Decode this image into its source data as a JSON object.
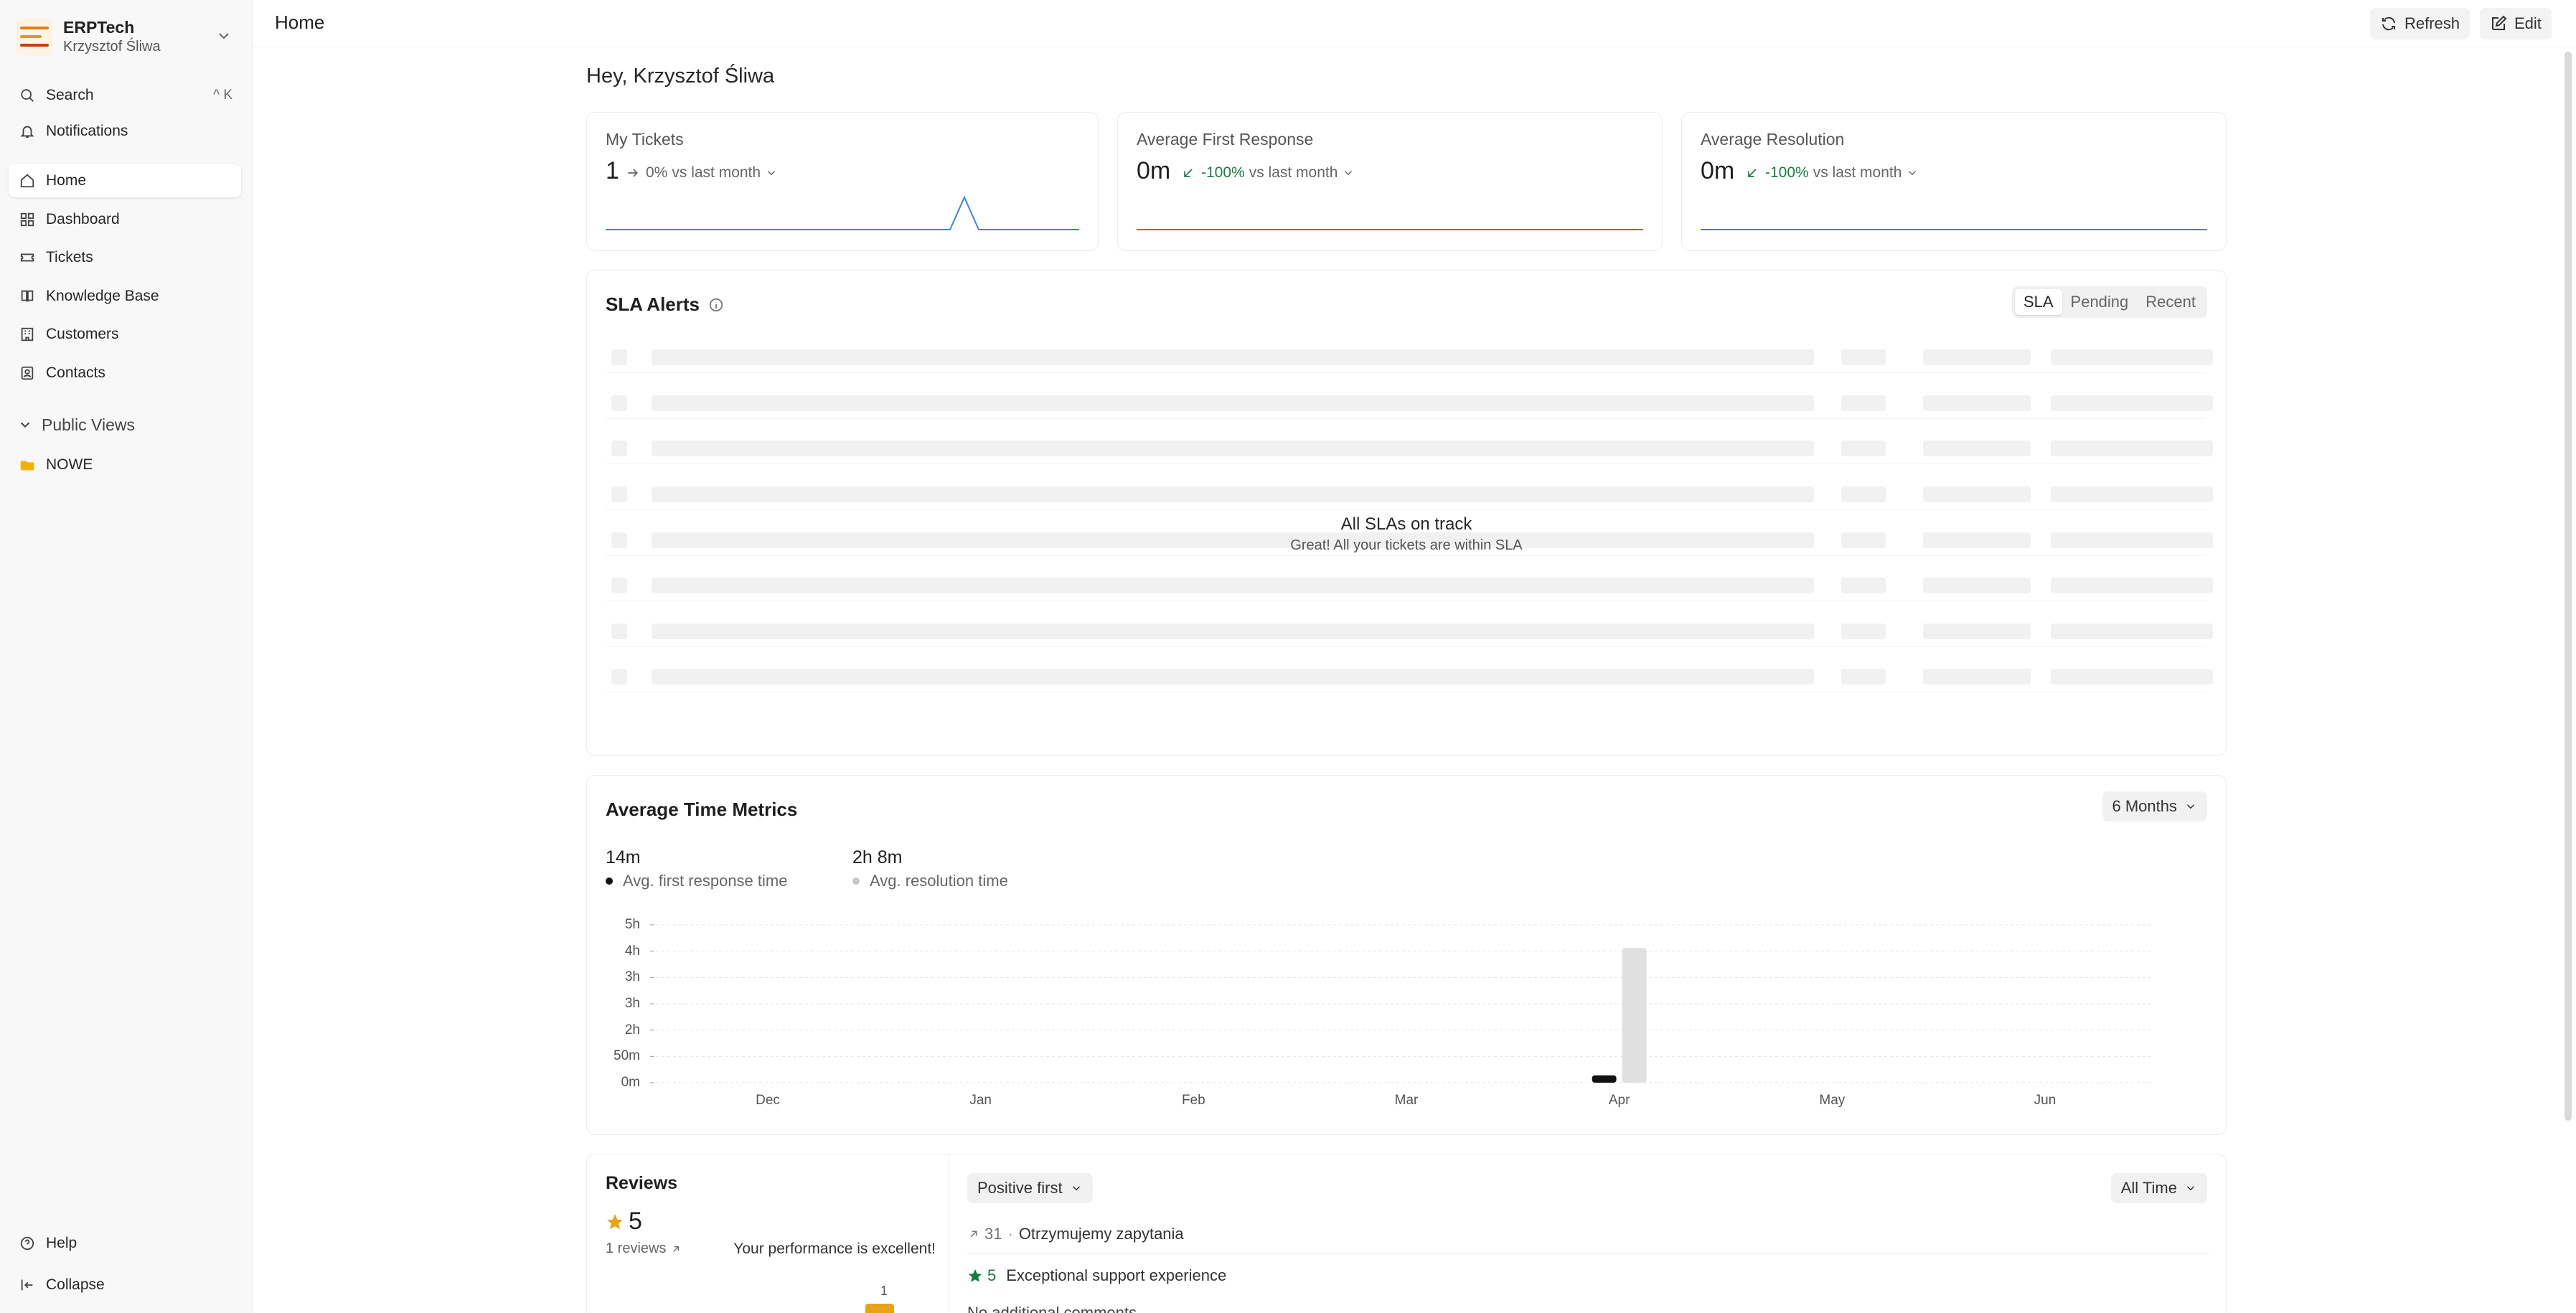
{
  "brand": {
    "name": "ERPTech",
    "user": "Krzysztof Śliwa"
  },
  "sidebar": {
    "search": {
      "label": "Search",
      "shortcut": "^ K"
    },
    "notifications": "Notifications",
    "items": [
      {
        "label": "Home",
        "icon": "home-icon",
        "active": true
      },
      {
        "label": "Dashboard",
        "icon": "dashboard-icon",
        "active": false
      },
      {
        "label": "Tickets",
        "icon": "ticket-icon",
        "active": false
      },
      {
        "label": "Knowledge Base",
        "icon": "book-icon",
        "active": false
      },
      {
        "label": "Customers",
        "icon": "building-icon",
        "active": false
      },
      {
        "label": "Contacts",
        "icon": "contact-icon",
        "active": false
      }
    ],
    "public_views": {
      "label": "Public Views",
      "items": [
        {
          "label": "NOWE",
          "icon": "folder-icon"
        }
      ]
    },
    "help": "Help",
    "collapse": "Collapse"
  },
  "header": {
    "title": "Home",
    "refresh": "Refresh",
    "edit": "Edit"
  },
  "greeting": "Hey, Krzysztof Śliwa",
  "metrics": [
    {
      "label": "My Tickets",
      "value": "1",
      "delta": "0%",
      "delta_suffix": "vs last month",
      "trend": "flat",
      "line_color": "#3b82f6"
    },
    {
      "label": "Average First Response",
      "value": "0m",
      "delta": "-100%",
      "delta_suffix": "vs last month",
      "trend": "down",
      "line_color": "#ef4444"
    },
    {
      "label": "Average Resolution",
      "value": "0m",
      "delta": "-100%",
      "delta_suffix": "vs last month",
      "trend": "down",
      "line_color": "#6366f1"
    }
  ],
  "sla": {
    "title": "SLA Alerts",
    "tabs": [
      "SLA",
      "Pending",
      "Recent"
    ],
    "active_tab": "SLA",
    "empty_title": "All SLAs on track",
    "empty_sub": "Great! All your tickets are within SLA"
  },
  "time_metrics": {
    "title": "Average Time Metrics",
    "range": "6 Months",
    "stats": [
      {
        "value": "14m",
        "label": "Avg. first response time",
        "color": "#111111"
      },
      {
        "value": "2h 8m",
        "label": "Avg. resolution time",
        "color": "#c8c8c8"
      }
    ]
  },
  "chart_data": {
    "type": "bar",
    "categories": [
      "Dec",
      "Jan",
      "Feb",
      "Mar",
      "Apr",
      "May",
      "Jun"
    ],
    "y_tick_labels": [
      "5h",
      "4h",
      "3h",
      "3h",
      "2h",
      "50m",
      "0m"
    ],
    "ylim_minutes": [
      0,
      300
    ],
    "series": [
      {
        "name": "Avg. first response time",
        "color": "#111111",
        "values_minutes": [
          0,
          0,
          0,
          0,
          14,
          0,
          0
        ]
      },
      {
        "name": "Avg. resolution time",
        "color": "#e0e0e0",
        "values_minutes": [
          0,
          0,
          0,
          0,
          256,
          0,
          0
        ]
      }
    ],
    "grid": true
  },
  "reviews": {
    "title": "Reviews",
    "rating": "5",
    "count": "1 reviews",
    "message": "Your performance is excellent!",
    "histogram_label": "1",
    "sort": "Positive first",
    "range": "All Time",
    "list": [
      {
        "ticket": "31",
        "subject": "Otrzymujemy zapytania"
      },
      {
        "stars": "5",
        "title": "Exceptional support experience",
        "comment": "No additional comments"
      }
    ]
  }
}
